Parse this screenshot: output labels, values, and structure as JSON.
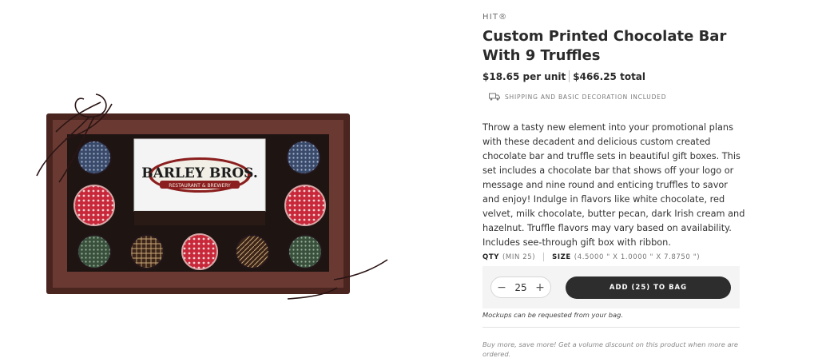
{
  "product": {
    "brand": "HIT®",
    "title": "Custom Printed Chocolate Bar With 9 Truffles",
    "unit_price": "$18.65 per unit",
    "total_price": "$466.25 total",
    "shipping_note": "SHIPPING AND BASIC DECORATION INCLUDED",
    "description": "Throw a tasty new element into your promotional plans with these decadent and delicious custom created chocolate bar and truffle sets in beautiful gift boxes. This set includes a chocolate bar that shows off your logo or message and nine round and enticing truffles to savor and enjoy! Indulge in flavors like white chocolate, red velvet, milk chocolate, butter pecan, dark Irish cream and hazelnut. Truffle flavors may vary based on availability. Includes see-through gift box with ribbon.",
    "image_logo_text": "BARLEY BROS.",
    "image_logo_subtext": "RESTAURANT & BREWERY"
  },
  "specs": {
    "qty_label": "QTY",
    "qty_min": "(MIN 25)",
    "size_label": "SIZE",
    "size_value": "(4.5000 \" X 1.0000 \" X 7.8750 \")"
  },
  "purchase": {
    "quantity": "25",
    "decrement": "−",
    "increment": "+",
    "add_button": "ADD (25) TO BAG",
    "mockup_note": "Mockups can be requested from your bag.",
    "volume_note": "Buy more, save more! Get a volume discount on this product when more are ordered."
  },
  "icons": {
    "shipping": "truck-icon",
    "decrement": "minus-icon",
    "increment": "plus-icon"
  },
  "colors": {
    "button_bg": "#2d2d2d",
    "panel_bg": "#f4f4f4",
    "box_brown": "#5a2e27",
    "truffle_red": "#c8283a"
  }
}
